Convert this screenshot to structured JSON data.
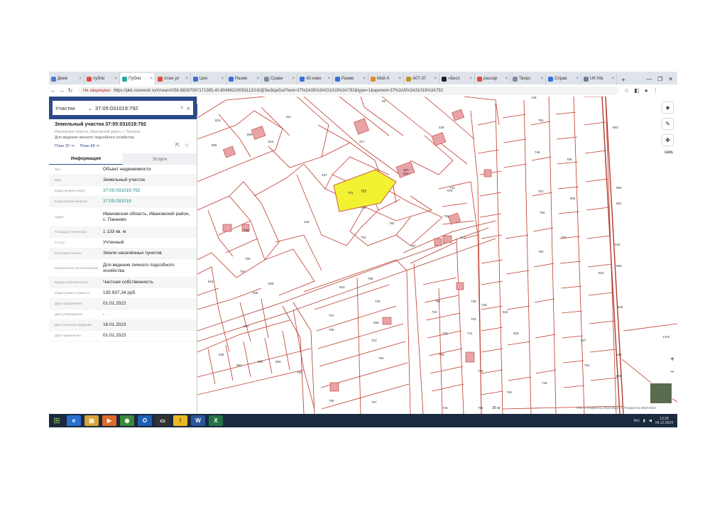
{
  "browser": {
    "tabs": [
      {
        "label": "Днев",
        "color": "#4a7cc7"
      },
      {
        "label": "публи",
        "color": "#e04c3c"
      },
      {
        "label": "Публи",
        "color": "#2aa7a0"
      },
      {
        "label": "план ул",
        "color": "#e04c3c"
      },
      {
        "label": "Цен",
        "color": "#3b6fd8"
      },
      {
        "label": "Разме",
        "color": "#3b6fd8"
      },
      {
        "label": "Сравн",
        "color": "#7b8ba0"
      },
      {
        "label": "43 ново",
        "color": "#3b6fd8"
      },
      {
        "label": "Разме",
        "color": "#3b6fd8"
      },
      {
        "label": "Мой А",
        "color": "#e08a2a"
      },
      {
        "label": "А07-37",
        "color": "#b8962a"
      },
      {
        "label": "«Бесп",
        "color": "#222222"
      },
      {
        "label": "рассир",
        "color": "#e04c3c"
      },
      {
        "label": "Творс",
        "color": "#7b8ba0"
      },
      {
        "label": "Справ",
        "color": "#3b6fd8"
      },
      {
        "label": "UK Ма",
        "color": "#6a7f9a"
      }
    ],
    "new_tab": "+",
    "not_secure": "Не защищено",
    "url": "https://pkk.rosreestr.ru/#/search/56.88267067171385,40.80496320093113/18/@5w3tqe5sd?text=37%3A05%3A031019%3A792&type=1&opened=37%3A5%3A31019%3A792"
  },
  "sidebar": {
    "search_type": "Участки",
    "search_query": "37:05:031019:792",
    "object_title": "Земельный участок 37:05:031019:792",
    "object_address": "Ивановская область, Ивановский район, с. Панеево",
    "object_use": "Для ведения личного подсобного хозяйства",
    "link_plan_zu": "План ЗУ ⇒",
    "link_plan_kk": "План КК ⇒",
    "tab_info": "Информация",
    "tab_services": "Услуги",
    "properties": [
      {
        "k": "Тип:",
        "v": "Объект недвижимости",
        "link": false
      },
      {
        "k": "Вид:",
        "v": "Земельный участок",
        "link": false
      },
      {
        "k": "Кадастровый номер:",
        "v": "37:05:031019:792",
        "link": true
      },
      {
        "k": "Кадастровый квартал:",
        "v": "37:05:031019",
        "link": true
      },
      {
        "k": "Адрес:",
        "v": "Ивановская область, Ивановский район, с. Панеево",
        "link": false
      },
      {
        "k": "Площадь уточненная:",
        "v": "1 133 кв. м",
        "link": false
      },
      {
        "k": "Статус:",
        "v": "Учтенный",
        "link": false
      },
      {
        "k": "Категория земель:",
        "v": "Земли населённых пунктов",
        "link": false
      },
      {
        "k": "Разрешенное использование:",
        "v": "Для ведения личного подсобного хозяйства",
        "link": false
      },
      {
        "k": "Форма собственности:",
        "v": "Частная собственность",
        "link": false
      },
      {
        "k": "Кадастровая стоимость:",
        "v": "135 937,34 руб.",
        "link": false
      },
      {
        "k": "Дата определения:",
        "v": "01.01.2022",
        "link": false
      },
      {
        "k": "Дата утверждения:",
        "v": "-",
        "link": false
      },
      {
        "k": "Дата внесения сведений:",
        "v": "16.01.2023",
        "link": false
      },
      {
        "k": "Дата применения:",
        "v": "01.01.2023",
        "link": false
      }
    ]
  },
  "map": {
    "parcel_labels": [
      "815",
      "811",
      "812",
      "805",
      "68",
      "217",
      "428",
      "746",
      "809",
      "754",
      "748",
      "756",
      "653",
      "810",
      "437",
      "367",
      "791",
      "795",
      "792",
      "794",
      "743",
      "751",
      "802",
      "650",
      "797",
      "243",
      "676",
      "726",
      "752",
      "770",
      "651",
      "798",
      "790",
      "789",
      "217",
      "753",
      "644",
      "660",
      "815",
      "836",
      "808",
      "797",
      "641",
      "816",
      "733",
      "746",
      "736",
      "822",
      "645",
      "693",
      "757",
      "703",
      "734",
      "732",
      "741",
      "823",
      "647",
      "648",
      "810",
      "705",
      "713",
      "707",
      "754",
      "739",
      "729",
      "761",
      "669",
      "648",
      "692",
      "694",
      "693",
      "702",
      "708",
      "707",
      "745",
      "756",
      "749",
      "746",
      "1476",
      "1476"
    ],
    "highlight_label": "792",
    "scale_label": "30 м",
    "attribution": "ПКК © Росреестр 2010-2024 | © Росреестр 2010-2024",
    "kn_label": "1476",
    "ctl_layers": "layers-icon",
    "ctl_measure": "ruler-icon",
    "ctl_locate": "crosshair-icon"
  },
  "taskbar": {
    "lang": "RU",
    "time": "13:28",
    "date": "04.12.2024"
  }
}
